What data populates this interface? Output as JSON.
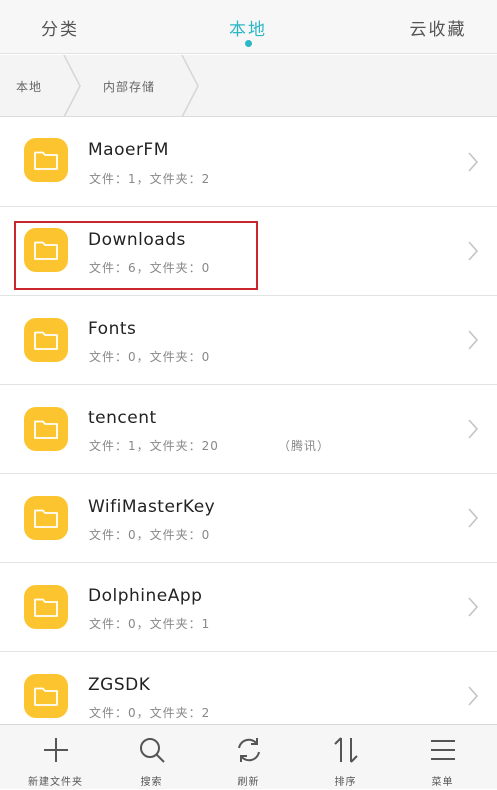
{
  "tabs": {
    "categories": "分类",
    "local": "本地",
    "cloud": "云收藏"
  },
  "breadcrumb": {
    "root": "本地",
    "current": "内部存储"
  },
  "folders": [
    {
      "name": "MaoerFM",
      "meta": "文件：1，文件夹：2",
      "note": ""
    },
    {
      "name": "Downloads",
      "meta": "文件：6，文件夹：0",
      "note": ""
    },
    {
      "name": "Fonts",
      "meta": "文件：0，文件夹：0",
      "note": ""
    },
    {
      "name": "tencent",
      "meta": "文件：1，文件夹：20",
      "note": "（腾讯）"
    },
    {
      "name": "WifiMasterKey",
      "meta": "文件：0，文件夹：0",
      "note": ""
    },
    {
      "name": "DolphineApp",
      "meta": "文件：0，文件夹：1",
      "note": ""
    },
    {
      "name": "ZGSDK",
      "meta": "文件：0，文件夹：2",
      "note": ""
    }
  ],
  "toolbar": {
    "new_folder": "新建文件夹",
    "search": "搜索",
    "refresh": "刷新",
    "sort": "排序",
    "menu": "菜单"
  },
  "colors": {
    "accent": "#2db7c6",
    "folder": "#fcc52f",
    "highlight": "#c9272d"
  }
}
